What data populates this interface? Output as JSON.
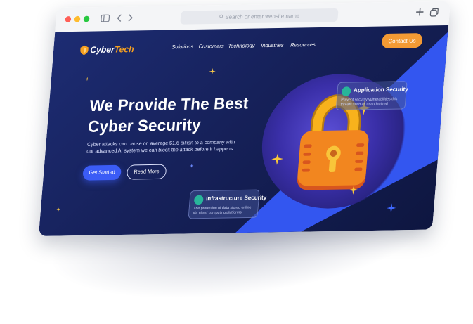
{
  "browser": {
    "address_placeholder": "Search or enter website name",
    "icons": [
      "sidebar-icon",
      "chevron-left-icon",
      "chevron-right-icon",
      "search-icon",
      "plus-icon",
      "tabs-icon"
    ]
  },
  "site": {
    "logo": {
      "part1": "Cyber",
      "part2": "Tech"
    },
    "nav": [
      "Solutions",
      "Customers",
      "Technology",
      "Industries",
      "Resources"
    ],
    "contact_button": "Contact Us",
    "hero": {
      "title_line1": "We Provide The Best",
      "title_line2": "Cyber Security",
      "description": "Cyber attacks can cause on average $1.6 billion to a company with our advanced AI system we can block the attack before it happens.",
      "primary_button": "Get Started",
      "secondary_button": "Read More"
    },
    "cards": {
      "application": {
        "title": "Application Security",
        "description": "Prevent security vulnerabilities this threats such as unauthorized"
      },
      "infrastructure": {
        "title": "Infrastructure Security",
        "description": "The protection of data stored online via cloud computing platforms"
      }
    },
    "colors": {
      "background": "#16215a",
      "accent_blue": "#3356f0",
      "accent_orange": "#f39a34",
      "lock_gold": "#f8b21c",
      "card_icon_green": "#28b59a"
    }
  }
}
